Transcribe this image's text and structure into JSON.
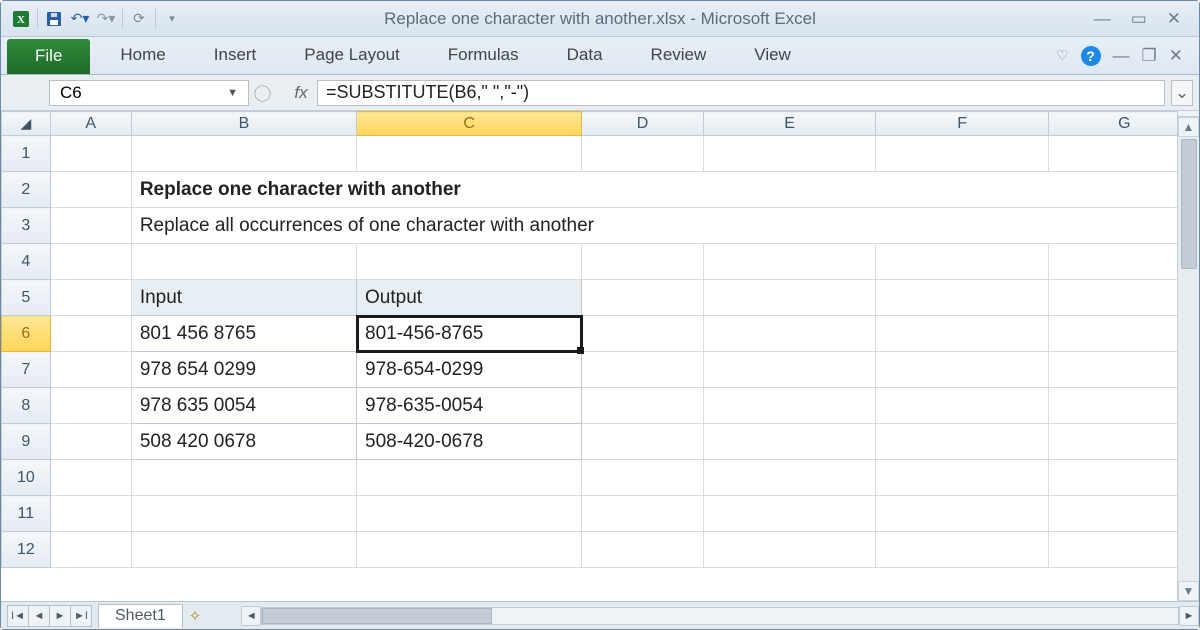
{
  "title": "Replace one character with another.xlsx  -  Microsoft Excel",
  "ribbon": {
    "file": "File",
    "tabs": [
      "Home",
      "Insert",
      "Page Layout",
      "Formulas",
      "Data",
      "Review",
      "View"
    ]
  },
  "namebox": "C6",
  "formula": "=SUBSTITUTE(B6,\" \",\"-\")",
  "columns": [
    "A",
    "B",
    "C",
    "D",
    "E",
    "F",
    "G"
  ],
  "rows": [
    "1",
    "2",
    "3",
    "4",
    "5",
    "6",
    "7",
    "8",
    "9",
    "10",
    "11",
    "12"
  ],
  "activeCol": "C",
  "activeRow": "6",
  "content": {
    "title_cell": "Replace one character with another",
    "subtitle_cell": "Replace all occurrences of one character with another",
    "hdr_input": "Input",
    "hdr_output": "Output",
    "rowsdata": [
      {
        "input": "801 456 8765",
        "output": "801-456-8765"
      },
      {
        "input": "978 654 0299",
        "output": "978-654-0299"
      },
      {
        "input": "978 635 0054",
        "output": "978-635-0054"
      },
      {
        "input": "508 420 0678",
        "output": "508-420-0678"
      }
    ]
  },
  "sheet": "Sheet1"
}
